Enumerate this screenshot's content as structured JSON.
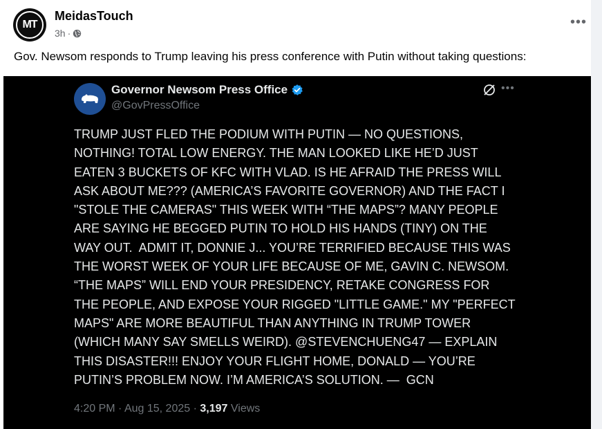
{
  "post": {
    "page_name": "MeidasTouch",
    "avatar_text": "MT",
    "time": "3h",
    "separator": "·",
    "text": "Gov. Newsom responds to Trump leaving his press conference with Putin without taking questions:",
    "more_icon": "more-horizontal-icon",
    "audience_icon": "globe-icon"
  },
  "tweet": {
    "display_name": "Governor Newsom Press Office",
    "handle": "@GovPressOffice",
    "verified_color": "#1d9bf0",
    "body_lines": [
      "TRUMP JUST FLED THE PODIUM WITH PUTIN — NO QUESTIONS,",
      "NOTHING! TOTAL LOW ENERGY. THE MAN LOOKED LIKE HE’D JUST",
      "EATEN 3 BUCKETS OF KFC WITH VLAD. IS HE AFRAID THE PRESS WILL",
      "ASK ABOUT ME??? (AMERICA’S FAVORITE GOVERNOR) AND THE FACT I",
      "\"STOLE THE CAMERAS\" THIS WEEK WITH “THE MAPS”? MANY PEOPLE",
      "ARE SAYING HE BEGGED PUTIN TO HOLD HIS HANDS (TINY) ON THE",
      "WAY OUT.  ADMIT IT, DONNIE J... YOU’RE TERRIFIED BECAUSE THIS WAS",
      "THE WORST WEEK OF YOUR LIFE BECAUSE OF ME, GAVIN C. NEWSOM.",
      "“THE MAPS” WILL END YOUR PRESIDENCY, RETAKE CONGRESS FOR",
      "THE PEOPLE, AND EXPOSE YOUR RIGGED \"LITTLE GAME.\" MY \"PERFECT",
      "MAPS\" ARE MORE BEAUTIFUL THAN ANYTHING IN TRUMP TOWER",
      "(WHICH MANY SAY SMELLS WEIRD). @STEVENCHUENG47 — EXPLAIN",
      "THIS DISASTER!!! ENJOY YOUR FLIGHT HOME, DONALD — YOU’RE",
      "PUTIN’S PROBLEM NOW. I’M AMERICA’S SOLUTION. —  GCN"
    ],
    "time": "4:20 PM",
    "date": "Aug 15, 2025",
    "views_count": "3,197",
    "views_label": "Views",
    "dot": "·"
  },
  "colors": {
    "tweet_background": "#000000",
    "tweet_text": "#e7e9ea",
    "tweet_muted": "#71767b",
    "post_background": "#ffffff",
    "feed_background": "#f0f2f5"
  }
}
